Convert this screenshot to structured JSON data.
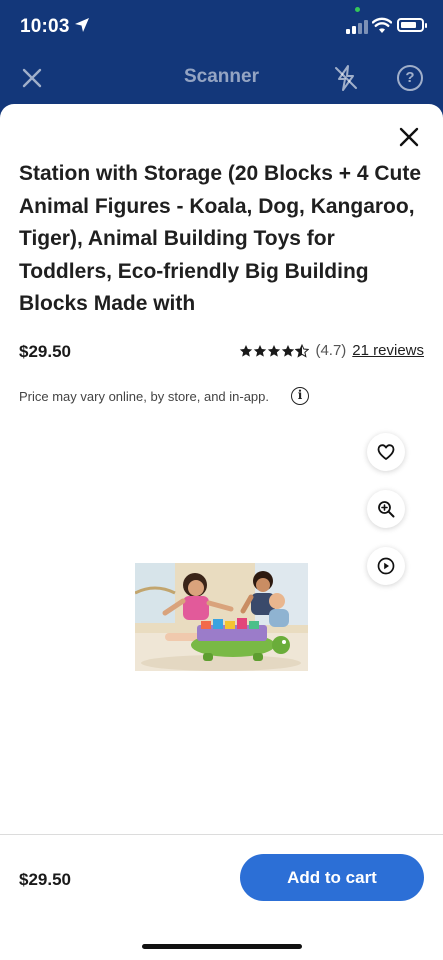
{
  "status_bar": {
    "time": "10:03",
    "icons": [
      "location-arrow-icon",
      "cellular-signal-icon",
      "wifi-icon",
      "battery-icon"
    ],
    "battery_level": 0.8
  },
  "scanner_header": {
    "title": "Scanner",
    "left_icon": "close-icon",
    "right_icons": [
      "flash-off-icon",
      "help-icon"
    ],
    "help_glyph": "?"
  },
  "product": {
    "title": "Station with Storage (20 Blocks + 4 Cute Animal Figures - Koala, Dog, Kangaroo, Tiger), Animal Building Toys for Toddlers, Eco-friendly Big Building Blocks Made with",
    "price": "$29.50",
    "rating_value": 4.7,
    "rating_text": "(4.7)",
    "reviews": "21 reviews",
    "price_note": "Price may vary online, by store, and in-app.",
    "info_glyph": "i",
    "side_actions": [
      "heart-icon",
      "zoom-in-icon",
      "play-icon"
    ]
  },
  "footer": {
    "price": "$29.50",
    "add_to_cart": "Add to cart"
  },
  "colors": {
    "header_bg": "#13377a",
    "primary_button": "#2c6fd6",
    "text": "#1f1f1f"
  }
}
